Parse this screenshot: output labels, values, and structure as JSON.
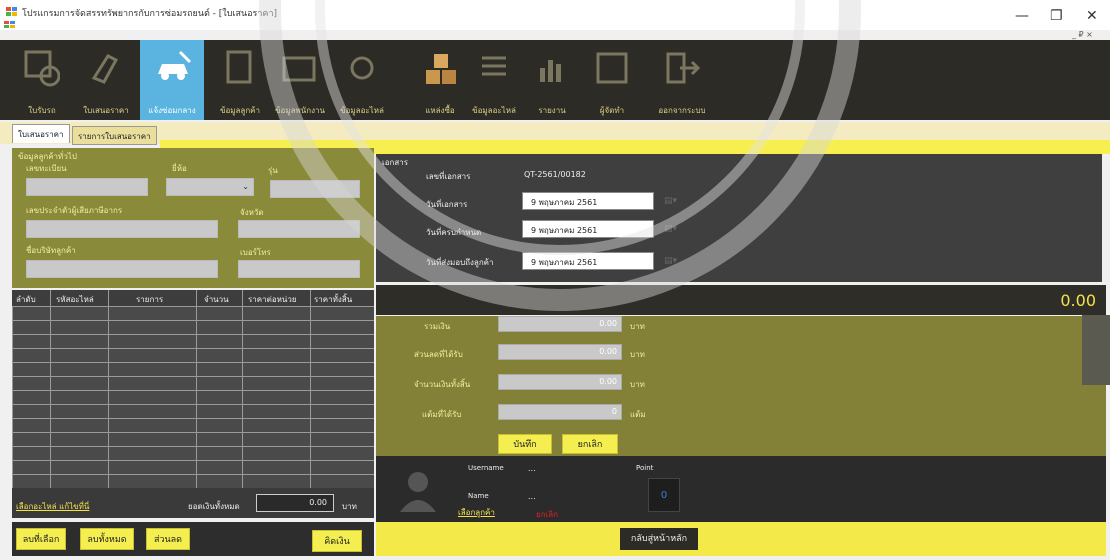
{
  "window": {
    "title": "โปรแกรมการจัดสรรทรัพยากรกับการซ่อมรถยนต์ - [ใบเสนอราคา]",
    "min_icon": "—",
    "restore_icon": "❐",
    "close_icon": "✕",
    "mdi_controls": "_ ₽ ×"
  },
  "toolbar": {
    "items": [
      {
        "label": "ใบรับรถ",
        "icon": "calendar-gear-icon"
      },
      {
        "label": "ใบเสนอราคา",
        "icon": "wrench-doc-icon"
      },
      {
        "label": "แจ้งซ่อมกลาง",
        "icon": "car-tools-icon"
      },
      {
        "label": "ข้อมูลลูกค้า",
        "icon": "clipboard-icon"
      },
      {
        "label": "ข้อมูลพนักงาน",
        "icon": "id-card-icon"
      },
      {
        "label": "ข้อมูลอะไหล่",
        "icon": "parts-icon"
      },
      {
        "label": "แหล่งซื้อ",
        "icon": "boxes-icon"
      },
      {
        "label": "ข้อมูลอะไหล่",
        "icon": "list-icon"
      },
      {
        "label": "รายงาน",
        "icon": "chart-icon"
      },
      {
        "label": "ผู้จัดทำ",
        "icon": "grid-icon"
      },
      {
        "label": "ออกจากระบบ",
        "icon": "exit-icon"
      }
    ]
  },
  "tabs": {
    "active": "ใบเสนอราคา",
    "second": "รายการใบเสนอราคา"
  },
  "customer": {
    "group_title": "ข้อมูลลูกค้าทั่วไป",
    "plate_label": "เลขทะเบียน",
    "brand_label": "ยี่ห้อ",
    "model_label": "รุ่น",
    "tax_label": "เลขประจำตัวผู้เสียภาษีอากร",
    "province_label": "จังหวัด",
    "company_label": "ชื่อบริษัทลูกค้า",
    "phone_label": "เบอร์โทร"
  },
  "grid": {
    "columns": [
      "ลำดับ",
      "รหัสอะไหล่",
      "รายการ",
      "จำนวน",
      "ราคาต่อหน่วย",
      "ราคาทั้งสิ้น"
    ]
  },
  "left_bottom": {
    "link": "เลือกอะไหล่ แก้ไขที่นี่",
    "total_label": "ยอดเงินทั้งหมด",
    "total_value": "0.00",
    "unit": "บาท"
  },
  "left_buttons": {
    "delete_selected": "ลบที่เลือก",
    "delete_all": "ลบทั้งหมด",
    "discount": "ส่วนลด",
    "calculate": "คิดเงิน"
  },
  "document": {
    "legend": "เอกสาร",
    "number_label": "เลขที่เอกสาร",
    "number_value": "QT-2561/00182",
    "date_label": "วันที่เอกสาร",
    "date_value": "9 พฤษภาคม 2561",
    "delivery_label": "วันที่ครบกำหนด",
    "delivery_value": "9 พฤษภาคม 2561",
    "due_label": "วันที่ส่งมอบถึงลูกค้า",
    "due_value": "9 พฤษภาคม 2561"
  },
  "total": {
    "value": "0.00"
  },
  "summary": {
    "subtotal_label": "รวมเงิน",
    "subtotal_value": "0.00",
    "discount_label": "ส่วนลดที่ได้รับ",
    "discount_value": "0.00",
    "grand_label": "จำนวนเงินทั้งสิ้น",
    "grand_value": "0.00",
    "points_label": "แต้มที่ได้รับ",
    "points_value": "0",
    "unit_baht": "บาท",
    "unit_points": "แต้ม",
    "save_button": "บันทึก",
    "cancel_button": "ยกเลิก"
  },
  "user": {
    "username_label": "Username",
    "username_value": "...",
    "name_label": "Name",
    "name_value": "...",
    "point_label": "Point",
    "point_value": "0",
    "choose_customer": "เลือกลูกค้า",
    "status_text": "ยกเลิก"
  },
  "bottom": {
    "home_button": "กลับสู่หน้าหลัก"
  },
  "colors": {
    "toolbar_bg": "#2d2b25",
    "accent_yellow": "#f4ee50",
    "olive_panel": "#8a8b3a",
    "total_yellow": "#f2e24b",
    "selected_blue": "#5ab4df"
  }
}
